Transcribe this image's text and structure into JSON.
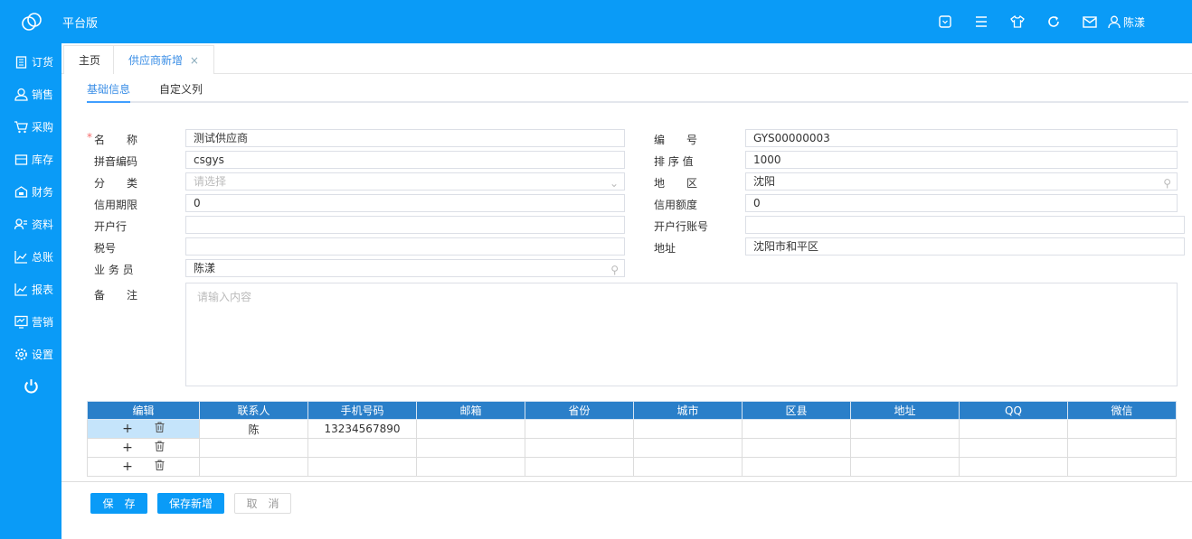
{
  "header": {
    "brand": "平台版",
    "user": "陈漾",
    "icons": [
      "dropdown-box-icon",
      "menu-icon",
      "shirt-icon",
      "refresh-icon",
      "mail-icon",
      "user-icon"
    ]
  },
  "sidebar": {
    "items": [
      {
        "label": "订货",
        "icon": "clipboard-icon"
      },
      {
        "label": "销售",
        "icon": "user-icon"
      },
      {
        "label": "采购",
        "icon": "cart-icon"
      },
      {
        "label": "库存",
        "icon": "box-icon"
      },
      {
        "label": "财务",
        "icon": "safe-icon"
      },
      {
        "label": "资料",
        "icon": "contacts-icon"
      },
      {
        "label": "总账",
        "icon": "chart-icon"
      },
      {
        "label": "报表",
        "icon": "chart-icon"
      },
      {
        "label": "营销",
        "icon": "monitor-icon"
      },
      {
        "label": "设置",
        "icon": "gear-icon"
      }
    ]
  },
  "tabs": [
    {
      "label": "主页"
    },
    {
      "label": "供应商新增"
    }
  ],
  "subtabs": [
    {
      "label": "基础信息"
    },
    {
      "label": "自定义列"
    }
  ],
  "form": {
    "name": {
      "label": "名　　称",
      "value": "测试供应商"
    },
    "pinyin": {
      "label": "拼音编码",
      "value": "csgys"
    },
    "category": {
      "label": "分　　类",
      "placeholder": "请选择"
    },
    "credit_days": {
      "label": "信用期限",
      "value": "0"
    },
    "bank": {
      "label": "开户行",
      "value": ""
    },
    "tax": {
      "label": "税号",
      "value": ""
    },
    "salesman": {
      "label": "业 务 员",
      "value": "陈漾"
    },
    "code": {
      "label": "编　　号",
      "value": "GYS00000003"
    },
    "sort": {
      "label": "排 序 值",
      "value": "1000"
    },
    "region": {
      "label": "地　　区",
      "value": "沈阳"
    },
    "credit_limit": {
      "label": "信用额度",
      "value": "0"
    },
    "account": {
      "label": "开户行账号",
      "value": ""
    },
    "address": {
      "label": "地址",
      "value": "沈阳市和平区"
    },
    "remark": {
      "label": "备　　注",
      "placeholder": "请输入内容"
    }
  },
  "table": {
    "headers": [
      "编辑",
      "联系人",
      "手机号码",
      "邮箱",
      "省份",
      "城市",
      "区县",
      "地址",
      "QQ",
      "微信"
    ],
    "rows": [
      [
        "陈",
        "13234567890",
        "",
        "",
        "",
        "",
        "",
        "",
        ""
      ],
      [
        "",
        "",
        "",
        "",
        "",
        "",
        "",
        "",
        ""
      ],
      [
        "",
        "",
        "",
        "",
        "",
        "",
        "",
        "",
        ""
      ]
    ]
  },
  "buttons": {
    "save": "保　存",
    "save_new": "保存新增",
    "cancel": "取　消"
  }
}
